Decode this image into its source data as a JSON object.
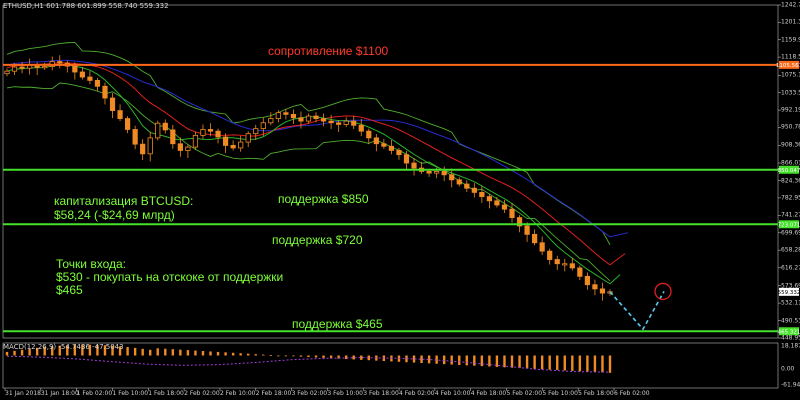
{
  "header": {
    "symbol_text": "ETHUSD,H1  601.788 601.899 558.740 559.332"
  },
  "macd": {
    "label": "MACD(12,26,9) -54.7436 -47.5043",
    "y_ticks": [
      "18.187",
      "0.00",
      "-61.9418"
    ]
  },
  "colors": {
    "background": "#000000",
    "candle": "#f08a24",
    "resistance": "#ff6a1a",
    "support": "#44e02a",
    "band_outer": "#4fae2c",
    "ma_fast": "#2ab32a",
    "ma_mid": "#e0201e",
    "ma_slow": "#2a2ad4",
    "projection": "#58c8f0",
    "target_circle": "#e02020",
    "macd_hist": "#f08a24",
    "macd_signal": "#a040d8"
  },
  "annotations": {
    "resistance": "сопротивление $1100",
    "support_850": "поддержка $850",
    "support_720": "поддержка $720",
    "support_465": "поддержка $465",
    "cap_line1": "капитализация BTCUSD:",
    "cap_line2": "$58,24 (-$24,69 млрд)",
    "entry_line1": "Точки входа:",
    "entry_line2": "$530 - покупать на отскоке от поддержки",
    "entry_line3": "$465"
  },
  "chart_data": {
    "type": "candlestick",
    "symbol": "ETHUSD",
    "timeframe": "H1",
    "ylim": [
      448.95,
      1242.75
    ],
    "y_ticks": [
      1242.75,
      1201.34,
      1159.93,
      1118.52,
      1075.11,
      1033.59,
      992.19,
      950.78,
      908.36,
      866.01,
      824.36,
      782.95,
      741.27,
      699.69,
      658.28,
      616.27,
      573.69,
      532.11,
      490.53,
      448.95
    ],
    "x_ticks": [
      "31 Jan 2018",
      "31 Jan 18:00",
      "1 Feb 02:00",
      "1 Feb 10:00",
      "1 Feb 18:00",
      "2 Feb 02:00",
      "2 Feb 10:00",
      "2 Feb 18:00",
      "3 Feb 02:00",
      "3 Feb 10:00",
      "3 Feb 18:00",
      "4 Feb 02:00",
      "4 Feb 10:00",
      "4 Feb 18:00",
      "5 Feb 02:00",
      "5 Feb 10:00",
      "5 Feb 18:00",
      "6 Feb 02:00"
    ],
    "levels": [
      {
        "name": "resistance",
        "value": 1100,
        "price_label": "1105.561"
      },
      {
        "name": "support",
        "value": 850,
        "price_label": "850.047"
      },
      {
        "name": "support",
        "value": 720,
        "price_label": "723.071"
      },
      {
        "name": "support",
        "value": 465,
        "price_label": "465.321"
      }
    ],
    "last_price_label": "559.332",
    "candles_close": [
      1085,
      1095,
      1092,
      1100,
      1094,
      1096,
      1108,
      1104,
      1097,
      1083,
      1071,
      1063,
      1049,
      1021,
      991,
      972,
      946,
      911,
      888,
      926,
      961,
      945,
      912,
      896,
      904,
      932,
      946,
      942,
      928,
      908,
      902,
      916,
      936,
      948,
      962,
      972,
      986,
      982,
      974,
      966,
      978,
      972,
      966,
      962,
      958,
      966,
      956,
      942,
      926,
      912,
      906,
      896,
      886,
      866,
      854,
      846,
      842,
      846,
      838,
      826,
      816,
      806,
      796,
      786,
      776,
      766,
      756,
      736,
      716,
      696,
      676,
      656,
      636,
      626,
      626,
      616,
      596,
      576,
      566,
      556,
      559
    ],
    "projection": [
      559,
      470,
      560
    ],
    "macd": {
      "ylim": [
        -61.9418,
        18.187
      ],
      "signal": [
        -2,
        -5,
        -10,
        -18,
        -25,
        -28,
        -26,
        -20,
        -12,
        -8,
        -6,
        -8,
        -12,
        -20,
        -30,
        -40,
        -46,
        -47.5
      ]
    }
  }
}
